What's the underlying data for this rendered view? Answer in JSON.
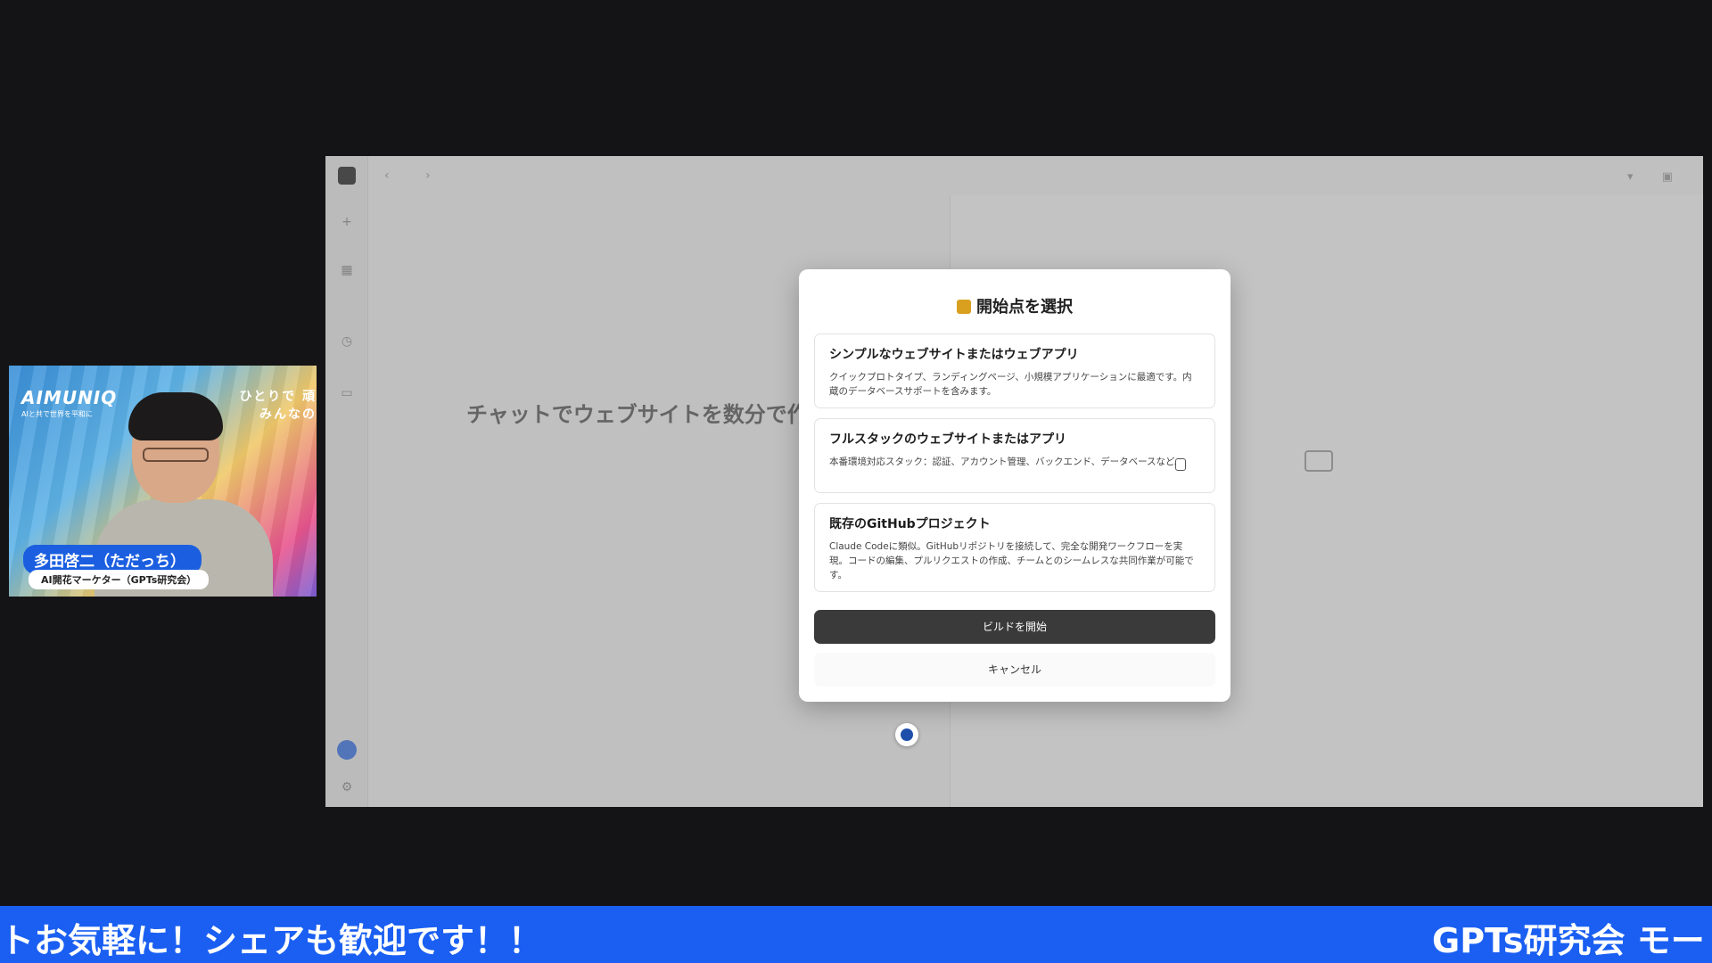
{
  "webcam": {
    "brand": "AIMUNIQ",
    "brand_sub": "AIと共で世界を平和に",
    "tagline_line1": "ひとりで 頑",
    "tagline_line2": "みんなの",
    "name": "多田啓二（ただっち）",
    "role": "AI開花マーケター（GPTs研究会）"
  },
  "modal": {
    "title": "開始点を選択",
    "title_icon": "construction-worker-icon",
    "options": [
      {
        "title": "シンプルなウェブサイトまたはウェブアプリ",
        "desc": "クイックプロトタイプ、ランディングページ、小規模アプリケーションに最適です。内蔵のデータベースサポートを含みます。"
      },
      {
        "title": "フルスタックのウェブサイトまたはアプリ",
        "desc": "本番環境対応スタック：認証、アカウント管理、バックエンド、データベースなど。"
      },
      {
        "title": "既存のGitHubプロジェクト",
        "desc": "Claude Codeに類似。GitHubリポジトリを接続して、完全な開発ワークフローを実現。コードの編集、プルリクエストの作成、チームとのシームレスな共同作業が可能です。"
      }
    ],
    "primary_button": "ビルドを開始",
    "cancel_button": "キャンセル"
  },
  "background_app": {
    "heading": "チャットでウェブサイトを数分で作"
  },
  "ticker": {
    "left_text": "トお気軽に！シェアも歓迎です！！",
    "right_text": "GPTs研究会 モー"
  }
}
